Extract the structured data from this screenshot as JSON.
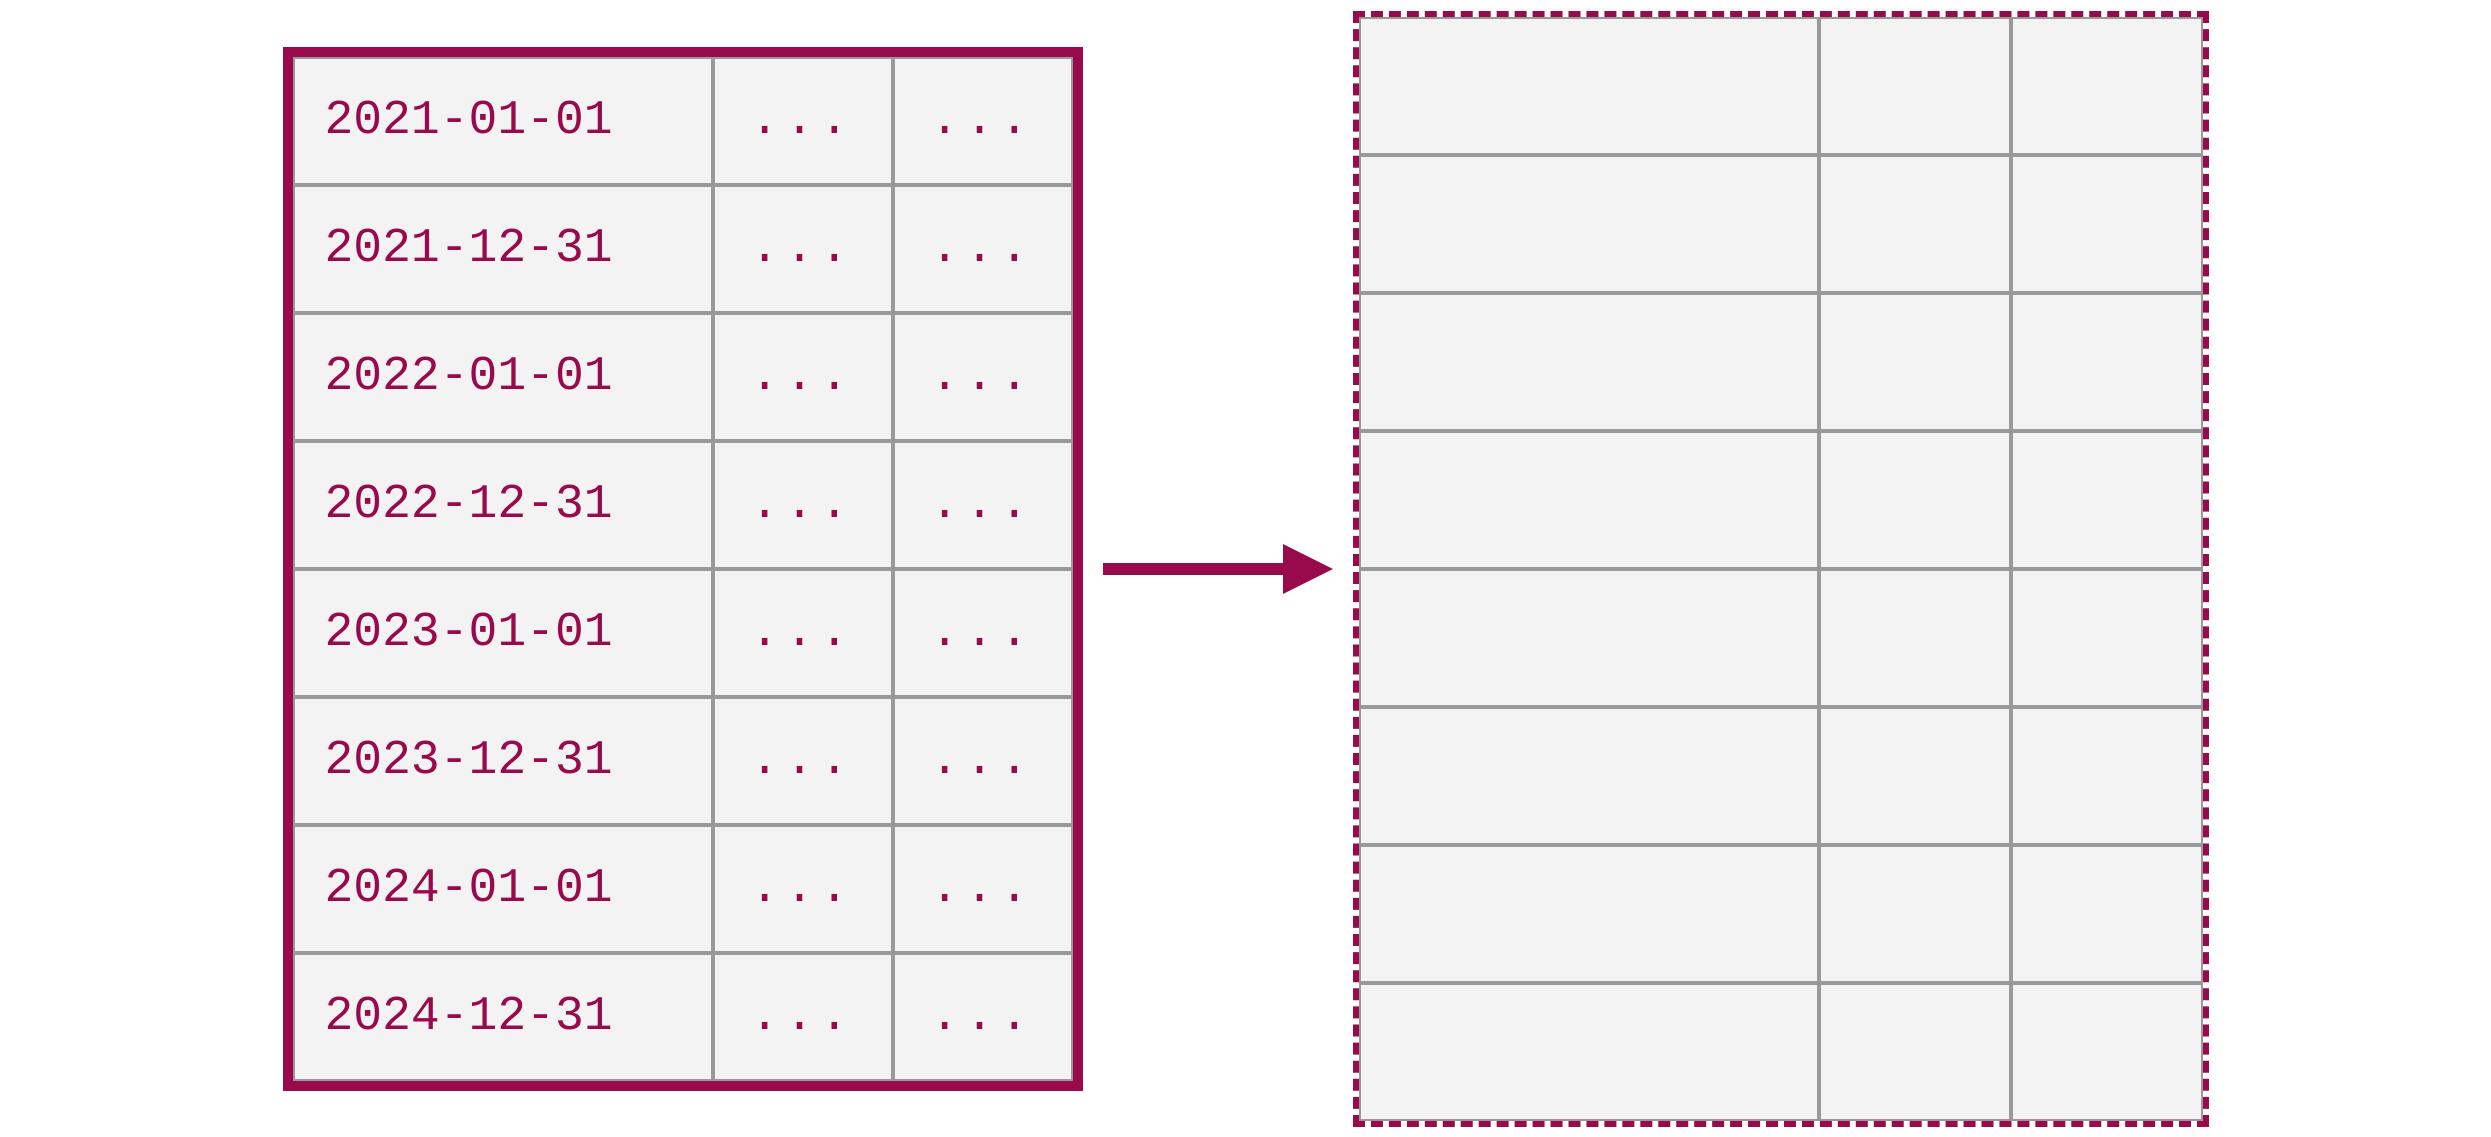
{
  "colors": {
    "primary": "#980a4c",
    "cell_bg": "#f3f3f3",
    "cell_border": "#999999"
  },
  "source_table": {
    "rows": [
      {
        "date": "2021-01-01",
        "col2": "...",
        "col3": "..."
      },
      {
        "date": "2021-12-31",
        "col2": "...",
        "col3": "..."
      },
      {
        "date": "2022-01-01",
        "col2": "...",
        "col3": "..."
      },
      {
        "date": "2022-12-31",
        "col2": "...",
        "col3": "..."
      },
      {
        "date": "2023-01-01",
        "col2": "...",
        "col3": "..."
      },
      {
        "date": "2023-12-31",
        "col2": "...",
        "col3": "..."
      },
      {
        "date": "2024-01-01",
        "col2": "...",
        "col3": "..."
      },
      {
        "date": "2024-12-31",
        "col2": "...",
        "col3": "..."
      }
    ]
  },
  "target_table": {
    "row_count": 8,
    "col_count": 3
  },
  "arrow": {
    "direction": "right"
  }
}
